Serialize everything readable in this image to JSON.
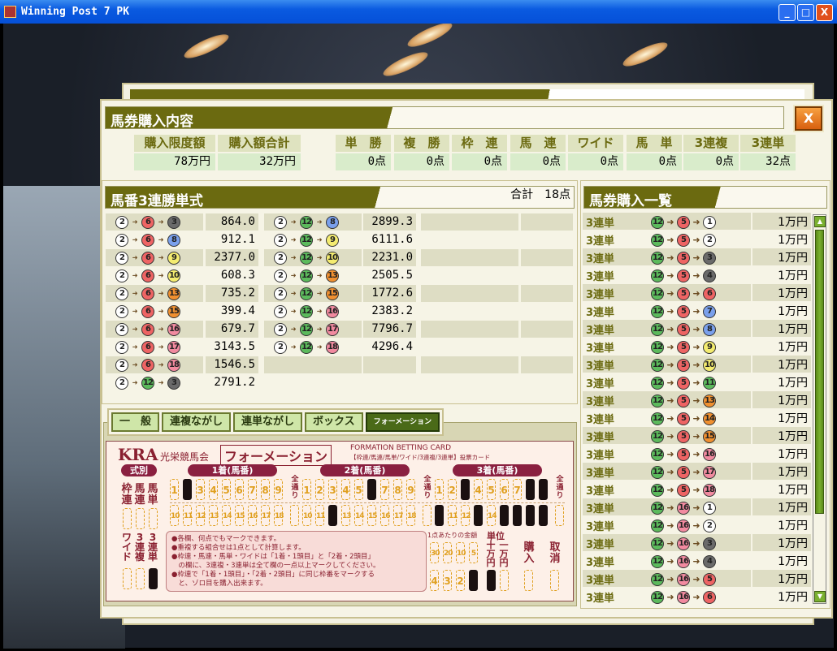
{
  "window": {
    "title": "Winning Post 7 PK",
    "minimize": "_",
    "maximize": "□",
    "close": "X"
  },
  "dialog": {
    "title": "馬券購入内容",
    "close_label": "X"
  },
  "summary": {
    "limit_label": "購入限度額",
    "limit_value": "78万円",
    "total_label": "購入額合計",
    "total_value": "32万円",
    "types": [
      {
        "label": "単　勝",
        "value": "0点"
      },
      {
        "label": "複　勝",
        "value": "0点"
      },
      {
        "label": "枠　連",
        "value": "0点"
      },
      {
        "label": "馬　連",
        "value": "0点"
      },
      {
        "label": "ワイド",
        "value": "0点"
      },
      {
        "label": "馬　単",
        "value": "0点"
      },
      {
        "label": "3連複",
        "value": "0点"
      },
      {
        "label": "3連単",
        "value": "32点"
      }
    ]
  },
  "odds_panel": {
    "title": "馬番3連勝単式",
    "total": "合計　18点",
    "rows": [
      {
        "combo": [
          2,
          6,
          3
        ],
        "odds": "864.0"
      },
      {
        "combo": [
          2,
          6,
          8
        ],
        "odds": "912.1"
      },
      {
        "combo": [
          2,
          6,
          9
        ],
        "odds": "2377.0"
      },
      {
        "combo": [
          2,
          6,
          10
        ],
        "odds": "608.3"
      },
      {
        "combo": [
          2,
          6,
          13
        ],
        "odds": "735.2"
      },
      {
        "combo": [
          2,
          6,
          15
        ],
        "odds": "399.4"
      },
      {
        "combo": [
          2,
          6,
          16
        ],
        "odds": "679.7"
      },
      {
        "combo": [
          2,
          6,
          17
        ],
        "odds": "3143.5"
      },
      {
        "combo": [
          2,
          6,
          18
        ],
        "odds": "1546.5"
      },
      {
        "combo": [
          2,
          12,
          3
        ],
        "odds": "2791.2"
      },
      {
        "combo": [
          2,
          12,
          8
        ],
        "odds": "2899.3"
      },
      {
        "combo": [
          2,
          12,
          9
        ],
        "odds": "6111.6"
      },
      {
        "combo": [
          2,
          12,
          10
        ],
        "odds": "2231.0"
      },
      {
        "combo": [
          2,
          12,
          13
        ],
        "odds": "2505.5"
      },
      {
        "combo": [
          2,
          12,
          15
        ],
        "odds": "1772.6"
      },
      {
        "combo": [
          2,
          12,
          16
        ],
        "odds": "2383.2"
      },
      {
        "combo": [
          2,
          12,
          17
        ],
        "odds": "7796.7"
      },
      {
        "combo": [
          2,
          12,
          18
        ],
        "odds": "4296.4"
      }
    ]
  },
  "tabs": [
    {
      "label": "一　般"
    },
    {
      "label": "連複ながし"
    },
    {
      "label": "連単ながし"
    },
    {
      "label": "ボックス"
    },
    {
      "label": "フォーメーション",
      "active": true
    }
  ],
  "card": {
    "brand": "KRA",
    "org": "光栄競馬会",
    "title": "フォーメーション",
    "subtitle": "FORMATION BETTING CARD",
    "subtitle2": "【枠連/馬連/馬単/ワイド/3連複/3連単】投票カード",
    "type_label": "式別",
    "types_top": [
      "枠連",
      "馬連",
      "馬単"
    ],
    "types_bottom": [
      "ワイド",
      "3連複",
      "3連単"
    ],
    "selected_type": "3連単",
    "columns": [
      {
        "label": "1着(馬番)",
        "marked": [
          2
        ]
      },
      {
        "label": "2着(馬番)",
        "marked": [
          6,
          12
        ]
      },
      {
        "label": "3着(馬番)",
        "marked": [
          3,
          8,
          9,
          10,
          13,
          15,
          16,
          17,
          18
        ]
      }
    ],
    "all_label": "全通り",
    "notes": [
      "●各欄、何点でもマークできます。",
      "●重複する組合せは1点として計算します。",
      "●枠連・馬連・馬単・ワイドは「1着・1頭目」と「2着・2頭目」",
      "　の欄に、3連複・3連単は全て欄の一点以上マークしてください。",
      "●枠連で「1着・1頭目」・「2着・2頭目」に同じ枠番をマークする",
      "　と、ゾロ目を購入出来ます。"
    ],
    "amount_label": "1点あたりの金額",
    "amount_top": [
      "30",
      "20",
      "10",
      "5"
    ],
    "amount_bottom": [
      "4",
      "3",
      "2",
      "1"
    ],
    "amount_marked": "1",
    "unit_label": "単位",
    "unit_options": [
      "十万円",
      "一万円"
    ],
    "unit_marked": "十万円",
    "buy_label": "購入",
    "cancel_label": "取消"
  },
  "purchase_list": {
    "title": "馬券購入一覧",
    "items": [
      {
        "type": "3連単",
        "combo": [
          12,
          5,
          1
        ],
        "amount": "1万円"
      },
      {
        "type": "3連単",
        "combo": [
          12,
          5,
          2
        ],
        "amount": "1万円"
      },
      {
        "type": "3連単",
        "combo": [
          12,
          5,
          3
        ],
        "amount": "1万円"
      },
      {
        "type": "3連単",
        "combo": [
          12,
          5,
          4
        ],
        "amount": "1万円"
      },
      {
        "type": "3連単",
        "combo": [
          12,
          5,
          6
        ],
        "amount": "1万円"
      },
      {
        "type": "3連単",
        "combo": [
          12,
          5,
          7
        ],
        "amount": "1万円"
      },
      {
        "type": "3連単",
        "combo": [
          12,
          5,
          8
        ],
        "amount": "1万円"
      },
      {
        "type": "3連単",
        "combo": [
          12,
          5,
          9
        ],
        "amount": "1万円"
      },
      {
        "type": "3連単",
        "combo": [
          12,
          5,
          10
        ],
        "amount": "1万円"
      },
      {
        "type": "3連単",
        "combo": [
          12,
          5,
          11
        ],
        "amount": "1万円"
      },
      {
        "type": "3連単",
        "combo": [
          12,
          5,
          13
        ],
        "amount": "1万円"
      },
      {
        "type": "3連単",
        "combo": [
          12,
          5,
          14
        ],
        "amount": "1万円"
      },
      {
        "type": "3連単",
        "combo": [
          12,
          5,
          15
        ],
        "amount": "1万円"
      },
      {
        "type": "3連単",
        "combo": [
          12,
          5,
          16
        ],
        "amount": "1万円"
      },
      {
        "type": "3連単",
        "combo": [
          12,
          5,
          17
        ],
        "amount": "1万円"
      },
      {
        "type": "3連単",
        "combo": [
          12,
          5,
          18
        ],
        "amount": "1万円"
      },
      {
        "type": "3連単",
        "combo": [
          12,
          16,
          1
        ],
        "amount": "1万円"
      },
      {
        "type": "3連単",
        "combo": [
          12,
          16,
          2
        ],
        "amount": "1万円"
      },
      {
        "type": "3連単",
        "combo": [
          12,
          16,
          3
        ],
        "amount": "1万円"
      },
      {
        "type": "3連単",
        "combo": [
          12,
          16,
          4
        ],
        "amount": "1万円"
      },
      {
        "type": "3連単",
        "combo": [
          12,
          16,
          5
        ],
        "amount": "1万円"
      },
      {
        "type": "3連単",
        "combo": [
          12,
          16,
          6
        ],
        "amount": "1万円"
      }
    ]
  },
  "frame_colors": {
    "1": "#ffffff",
    "2": "#ffffff",
    "3": "#6a6a6a",
    "4": "#6a6a6a",
    "5": "#ee6464",
    "6": "#ee6464",
    "7": "#7aa0ec",
    "8": "#7aa0ec",
    "9": "#f4ec70",
    "10": "#f4ec70",
    "11": "#5cba5c",
    "12": "#5cba5c",
    "13": "#f09030",
    "14": "#f09030",
    "15": "#f09030",
    "16": "#f28aa0",
    "17": "#f28aa0",
    "18": "#f28aa0"
  }
}
